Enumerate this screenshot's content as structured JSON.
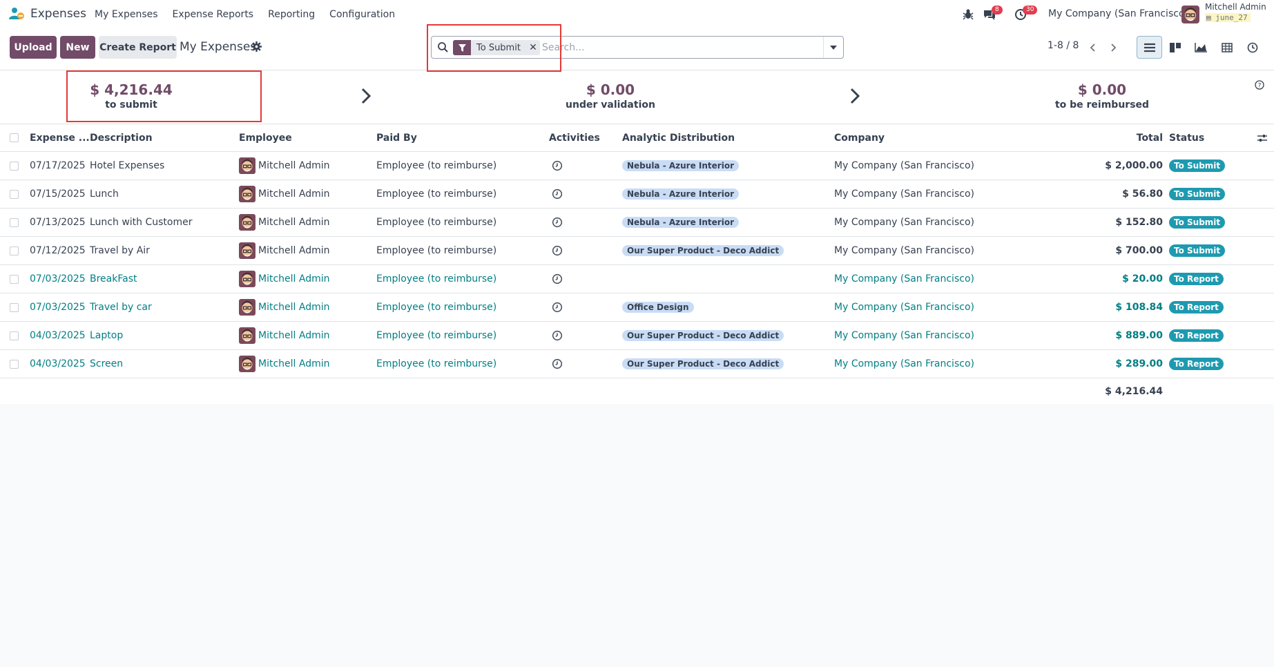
{
  "navbar": {
    "app_name": "Expenses",
    "menu": [
      "My Expenses",
      "Expense Reports",
      "Reporting",
      "Configuration"
    ],
    "messages_count": "8",
    "activities_count": "30",
    "company": "My Company (San Francisco)",
    "user_name": "Mitchell Admin",
    "db_name": "june_27"
  },
  "toolbar": {
    "upload_label": "Upload",
    "new_label": "New",
    "create_report_label": "Create Report",
    "breadcrumb": "My Expenses"
  },
  "search": {
    "facet_label": "To Submit",
    "placeholder": "Search..."
  },
  "pager": {
    "value": "1-8 / 8"
  },
  "summary": [
    {
      "amount": "$ 4,216.44",
      "label": "to submit"
    },
    {
      "amount": "$ 0.00",
      "label": "under validation"
    },
    {
      "amount": "$ 0.00",
      "label": "to be reimbursed"
    }
  ],
  "table": {
    "columns": {
      "date": "Expense ...",
      "description": "Description",
      "employee": "Employee",
      "paid_by": "Paid By",
      "activities": "Activities",
      "analytic": "Analytic Distribution",
      "company": "Company",
      "total": "Total",
      "status": "Status"
    },
    "rows": [
      {
        "date": "07/17/2025",
        "description": "Hotel Expenses",
        "employee": "Mitchell Admin",
        "paid_by": "Employee (to reimburse)",
        "analytic": "Nebula - Azure Interior",
        "company": "My Company (San Francisco)",
        "total": "$ 2,000.00",
        "status": "To Submit"
      },
      {
        "date": "07/15/2025",
        "description": "Lunch",
        "employee": "Mitchell Admin",
        "paid_by": "Employee (to reimburse)",
        "analytic": "Nebula - Azure Interior",
        "company": "My Company (San Francisco)",
        "total": "$ 56.80",
        "status": "To Submit"
      },
      {
        "date": "07/13/2025",
        "description": "Lunch with Customer",
        "employee": "Mitchell Admin",
        "paid_by": "Employee (to reimburse)",
        "analytic": "Nebula - Azure Interior",
        "company": "My Company (San Francisco)",
        "total": "$ 152.80",
        "status": "To Submit"
      },
      {
        "date": "07/12/2025",
        "description": "Travel by Air",
        "employee": "Mitchell Admin",
        "paid_by": "Employee (to reimburse)",
        "analytic": "Our Super Product - Deco Addict",
        "company": "My Company (San Francisco)",
        "total": "$ 700.00",
        "status": "To Submit"
      },
      {
        "date": "07/03/2025",
        "description": "BreakFast",
        "employee": "Mitchell Admin",
        "paid_by": "Employee (to reimburse)",
        "analytic": "",
        "company": "My Company (San Francisco)",
        "total": "$ 20.00",
        "status": "To Report"
      },
      {
        "date": "07/03/2025",
        "description": "Travel by car",
        "employee": "Mitchell Admin",
        "paid_by": "Employee (to reimburse)",
        "analytic": "Office Design",
        "company": "My Company (San Francisco)",
        "total": "$ 108.84",
        "status": "To Report"
      },
      {
        "date": "04/03/2025",
        "description": "Laptop",
        "employee": "Mitchell Admin",
        "paid_by": "Employee (to reimburse)",
        "analytic": "Our Super Product - Deco Addict",
        "company": "My Company (San Francisco)",
        "total": "$ 889.00",
        "status": "To Report"
      },
      {
        "date": "04/03/2025",
        "description": "Screen",
        "employee": "Mitchell Admin",
        "paid_by": "Employee (to reimburse)",
        "analytic": "Our Super Product - Deco Addict",
        "company": "My Company (San Francisco)",
        "total": "$ 289.00",
        "status": "To Report"
      }
    ],
    "grand_total": "$ 4,216.44"
  },
  "colors": {
    "brand": "#714b67",
    "link": "#017e84",
    "status_badge": "#1e9ab0",
    "tag": "#c9dcf5",
    "notification_badge": "#e03e4f",
    "annotation": "#e53935"
  }
}
